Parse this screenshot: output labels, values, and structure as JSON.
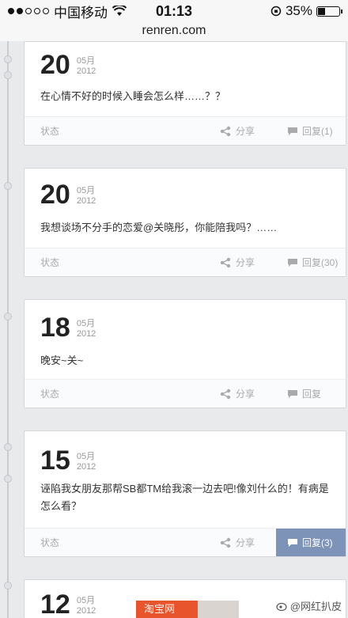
{
  "status_bar": {
    "carrier": "中国移动",
    "time": "01:13",
    "battery": "35%",
    "battery_level": 0.35
  },
  "url": "renren.com",
  "footer_labels": {
    "status": "状态",
    "share": "分享"
  },
  "posts": [
    {
      "day": "20",
      "month": "05月",
      "year": "2012",
      "content": "在心情不好的时候入睡会怎么样……？？",
      "reply": "回复(1)"
    },
    {
      "day": "20",
      "month": "05月",
      "year": "2012",
      "content": "我想谈场不分手的恋爱@关晓彤，你能陪我吗？……",
      "reply": "回复(30)"
    },
    {
      "day": "18",
      "month": "05月",
      "year": "2012",
      "content": "晚安~关~",
      "reply": "回复"
    },
    {
      "day": "15",
      "month": "05月",
      "year": "2012",
      "content": "诬陷我女朋友那帮SB都TM给我滚一边去吧!像刘什么的！有病是怎么看？",
      "reply": "回复(3)"
    },
    {
      "day": "12",
      "month": "05月",
      "year": "2012"
    }
  ],
  "overlay": {
    "ad_label": "淘宝网",
    "source": "@网红扒皮"
  },
  "colors": {
    "reply_active": "#7e93b8",
    "ad": "#e8552d"
  }
}
